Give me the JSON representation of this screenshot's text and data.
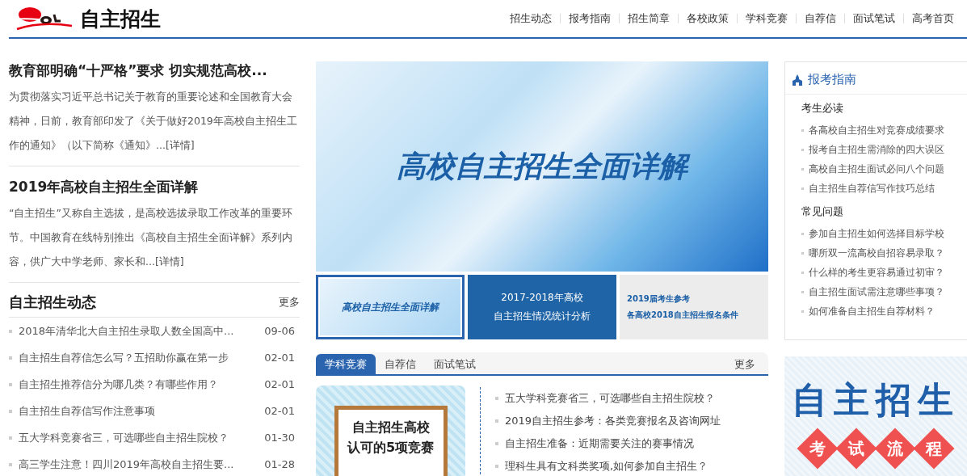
{
  "header": {
    "site_title": "自主招生",
    "nav": [
      "招生动态",
      "报考指南",
      "招生简章",
      "各校政策",
      "学科竞赛",
      "自荐信",
      "面试笔试",
      "高考首页"
    ]
  },
  "articles": [
    {
      "title": "教育部明确“十严格”要求 切实规范高校...",
      "summary": "为贯彻落实习近平总书记关于教育的重要论述和全国教育大会精神，日前，教育部印发了《关于做好2019年高校自主招生工作的通知》（以下简称《通知》...",
      "more_link": "[详情]"
    },
    {
      "title": "2019年高校自主招生全面详解",
      "summary": "“自主招生”又称自主选拔，是高校选拔录取工作改革的重要环节。中国教育在线特别推出《高校自主招生全面详解》系列内容，供广大中学老师、家长和...",
      "more_link": "[详情]"
    }
  ],
  "news": {
    "title": "自主招生动态",
    "more": "更多",
    "items": [
      {
        "title": "2018年清华北大自主招生录取人数全国高中...",
        "date": "09-06"
      },
      {
        "title": "自主招生自荐信怎么写？五招助你赢在第一步",
        "date": "02-01"
      },
      {
        "title": "自主招生推荐信分为哪几类？有哪些作用？",
        "date": "02-01"
      },
      {
        "title": "自主招生自荐信写作注意事项",
        "date": "02-01"
      },
      {
        "title": "五大学科竞赛省三，可选哪些自主招生院校？",
        "date": "01-30"
      },
      {
        "title": "高三学生注意！四川2019年高校自主招生要...",
        "date": "01-28"
      }
    ]
  },
  "banner": {
    "title": "高校自主招生全面详解"
  },
  "thumbnails": [
    {
      "kind": "pattern",
      "lines": [
        "高校自主招生全面详解"
      ],
      "selected": true
    },
    {
      "kind": "photo",
      "lines": [
        "2017-2018年高校",
        "自主招生情况统计分析"
      ],
      "selected": false
    },
    {
      "kind": "paper",
      "lines": [
        "2019届考生参考",
        "各高校2018自主招生报名条件"
      ],
      "selected": false
    }
  ],
  "tabs": {
    "items": [
      {
        "label": "学科竞赛",
        "selected": true
      },
      {
        "label": "自荐信",
        "selected": false
      },
      {
        "label": "面试笔试",
        "selected": false
      }
    ],
    "more": "更多"
  },
  "contest_card": {
    "lines": [
      "自主招生高校",
      "认可的5项竞赛"
    ]
  },
  "contest_links": [
    "五大学科竞赛省三，可选哪些自主招生院校？",
    "2019自主招生参考：各类竞赛报名及咨询网址",
    "自主招生准备：近期需要关注的赛事情况",
    "理科生具有文科类奖项,如何参加自主招生？"
  ],
  "guide": {
    "title": "报考指南",
    "groups": [
      {
        "heading": "考生必读",
        "links": [
          "各高校自主招生对竞赛成绩要求",
          "报考自主招生需消除的四大误区",
          "高校自主招生面试必问八个问题",
          "自主招生自荐信写作技巧总结"
        ]
      },
      {
        "heading": "常见问题",
        "links": [
          "参加自主招生如何选择目标学校",
          "哪所双一流高校自招容易录取？",
          "什么样的考生更容易通过初审？",
          "自主招生面试需注意哪些事项？",
          "如何准备自主招生自荐材料？"
        ]
      }
    ]
  },
  "process_banner": {
    "title": "自主招生",
    "steps": [
      "考",
      "试",
      "流",
      "程"
    ]
  }
}
